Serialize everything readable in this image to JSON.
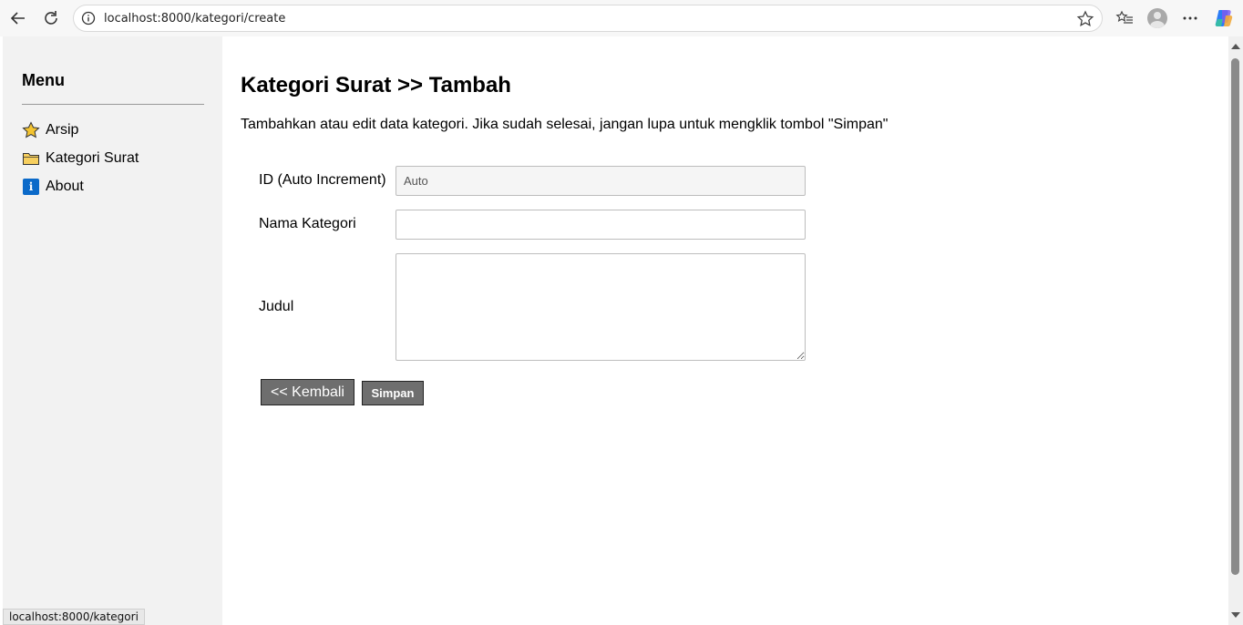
{
  "browser": {
    "url": "localhost:8000/kategori/create",
    "icons": [
      "back-icon",
      "refresh-icon",
      "site-info-icon",
      "favorite-star-icon",
      "favorites-icon",
      "profile-icon",
      "more-icon",
      "copilot-icon"
    ]
  },
  "sidebar": {
    "title": "Menu",
    "items": [
      {
        "label": "Arsip",
        "icon": "star-icon"
      },
      {
        "label": "Kategori Surat",
        "icon": "folder-icon"
      },
      {
        "label": "About",
        "icon": "info-icon",
        "icon_glyph": "i"
      }
    ]
  },
  "main": {
    "title": "Kategori Surat >> Tambah",
    "description": "Tambahkan atau edit data kategori. Jika sudah selesai, jangan lupa untuk mengklik tombol \"Simpan\"",
    "form": {
      "id_label": "ID (Auto Increment)",
      "id_value": "Auto",
      "nama_label": "Nama Kategori",
      "nama_value": "",
      "judul_label": "Judul",
      "judul_value": ""
    },
    "buttons": {
      "back": "<< Kembali",
      "save": "Simpan"
    }
  },
  "status_bar": {
    "link": "localhost:8000/kategori"
  },
  "colors": {
    "sidebar_bg": "#f2f2f2",
    "button_bg": "#6e6e6e",
    "info_icon": "#0b6ac9",
    "star_fill": "#f4c430",
    "folder_fill": "#f7cf5e"
  }
}
